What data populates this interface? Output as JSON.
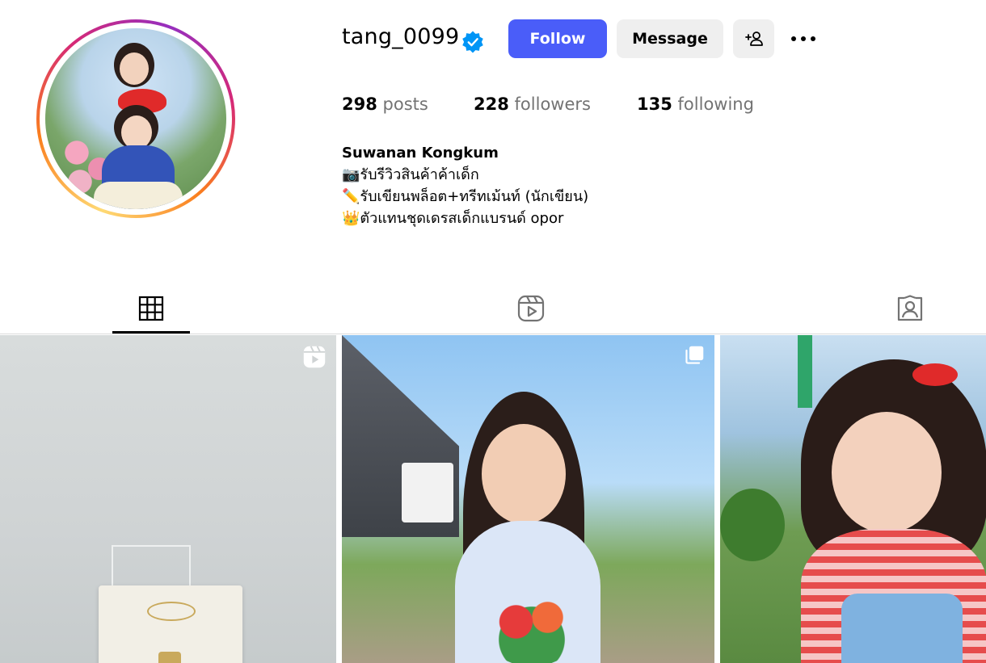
{
  "profile": {
    "username": "tang_0099",
    "verified_icon": "verified-badge-icon",
    "follow_label": "Follow",
    "message_label": "Message",
    "add_user_icon": "add-person-icon",
    "more_icon": "more-horizontal-icon",
    "avatar_alt": "profile-photo"
  },
  "stats": {
    "posts_count": "298",
    "posts_label": "posts",
    "followers_count": "228",
    "followers_label": "followers",
    "following_count": "135",
    "following_label": "following"
  },
  "bio": {
    "name": "Suwanan Kongkum",
    "line1": "📷รับรีวิวสินค้าค้าเด็ก",
    "line2": "✏️รับเขียนพล็อต+ทรีทเม้นท์ (นักเขียน)",
    "line3": "👑ตัวแทนชุดเดรสเด็กแบรนด์ opor"
  },
  "tabs": [
    {
      "icon": "grid-icon",
      "active": true
    },
    {
      "icon": "reels-icon",
      "active": false
    },
    {
      "icon": "tagged-icon",
      "active": false
    }
  ],
  "posts": [
    {
      "type": "reel",
      "overlay_icon": "reels-icon"
    },
    {
      "type": "carousel",
      "overlay_icon": "carousel-icon"
    },
    {
      "type": "photo",
      "overlay_icon": ""
    }
  ],
  "colors": {
    "follow_bg": "#4a5df9",
    "secondary_btn_bg": "#efefef",
    "muted_text": "#737373",
    "verified_blue": "#0095f6"
  }
}
